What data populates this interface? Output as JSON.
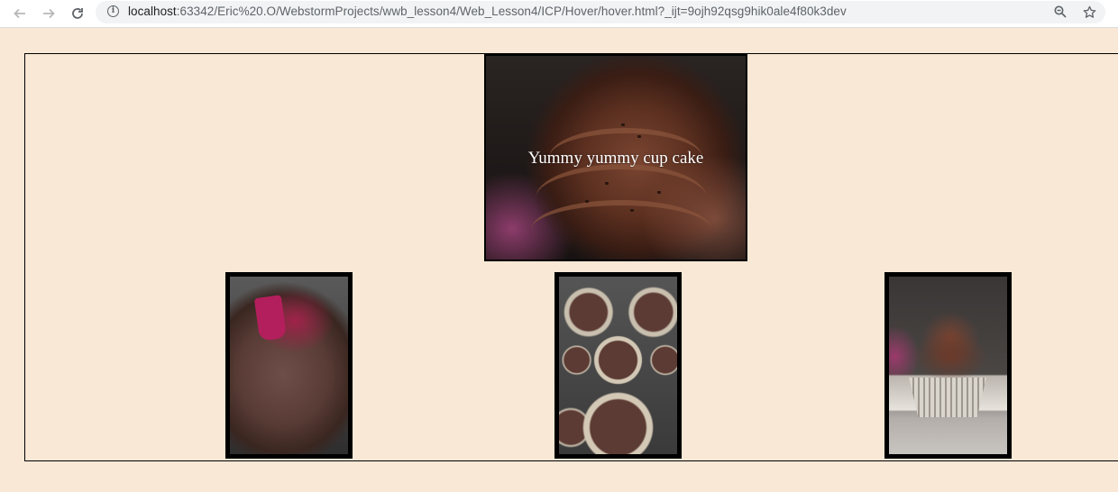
{
  "browser": {
    "back_icon": "arrow-left-icon",
    "forward_icon": "arrow-right-icon",
    "reload_icon": "reload-icon",
    "info_icon": "info-icon",
    "url_host": "localhost",
    "url_rest": ":63342/Eric%20.O/WebstormProjects/wwb_lesson4/Web_Lesson4/ICP/Hover/hover.html?_ijt=9ojh92qsg9hik0ale4f80k3dev",
    "zoom_icon": "zoom-icon",
    "bookmark_icon": "star-icon"
  },
  "page": {
    "hero": {
      "caption": "Yummy yummy cup cake",
      "image": "chocolate-cupcake-photo"
    },
    "thumbnails": [
      {
        "image": "chocolate-batter-bowl-photo"
      },
      {
        "image": "cupcake-liners-in-pan-photo"
      },
      {
        "image": "frosted-cupcake-photo"
      }
    ]
  },
  "colors": {
    "page_background": "#f9e8d5",
    "border": "#000000"
  }
}
